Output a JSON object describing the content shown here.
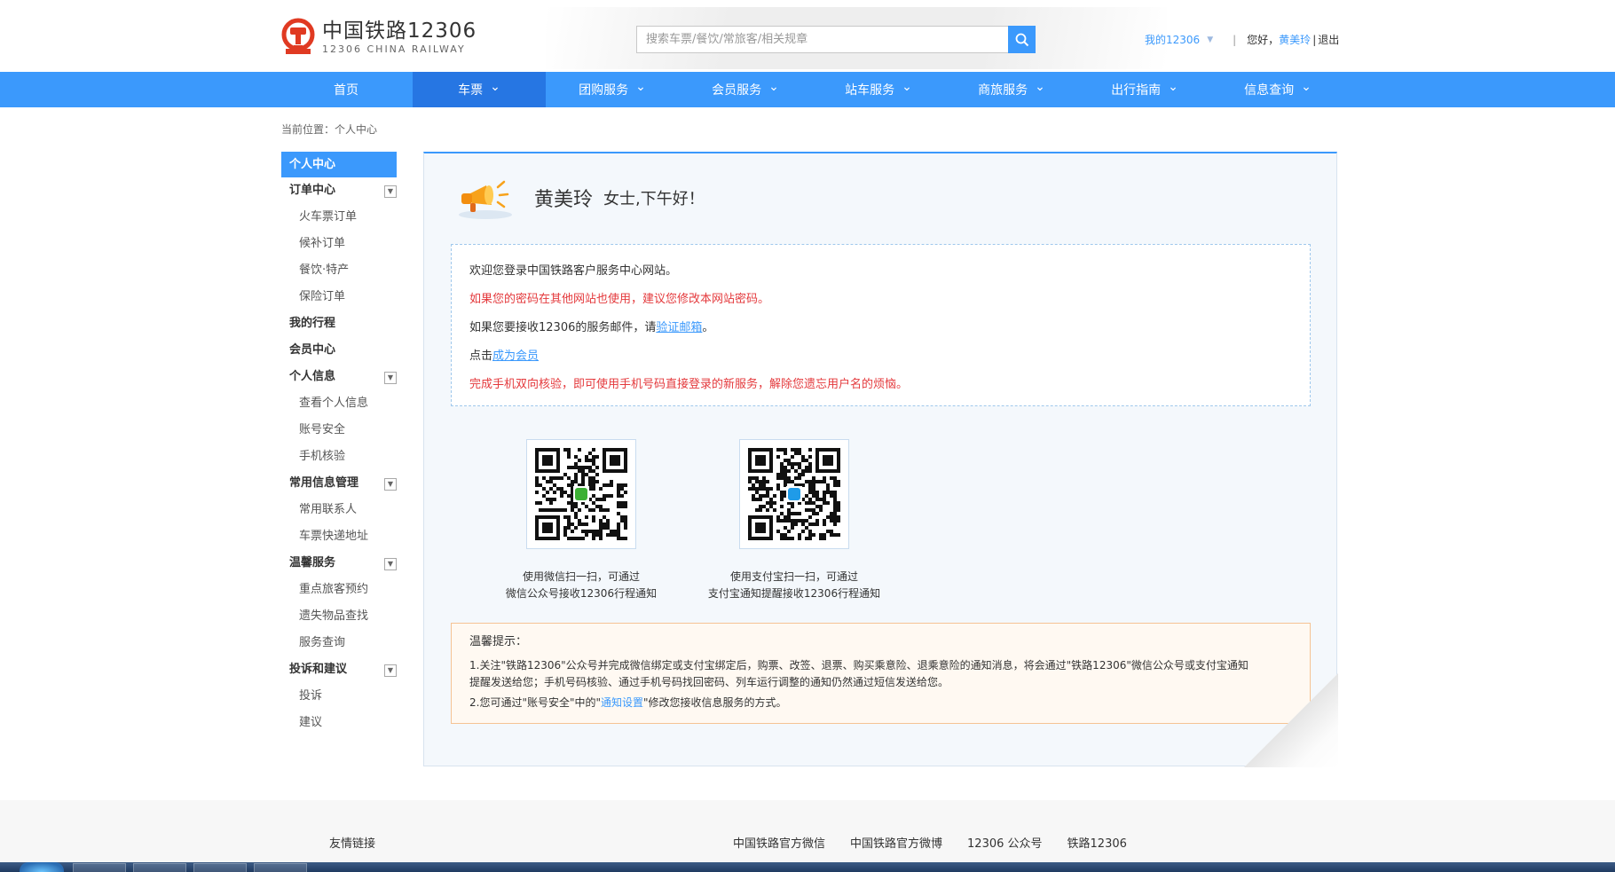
{
  "header": {
    "logo_cn": "中国铁路12306",
    "logo_en": "12306 CHINA RAILWAY",
    "search_placeholder": "搜索车票/餐饮/常旅客/相关规章",
    "my12306": "我的12306",
    "greeting_prefix": "您好，",
    "username": "黄美玲",
    "divider": "|",
    "logout": "退出"
  },
  "nav": [
    {
      "label": "首页",
      "has_dropdown": false,
      "active": false
    },
    {
      "label": "车票",
      "has_dropdown": true,
      "active": true
    },
    {
      "label": "团购服务",
      "has_dropdown": true,
      "active": false
    },
    {
      "label": "会员服务",
      "has_dropdown": true,
      "active": false
    },
    {
      "label": "站车服务",
      "has_dropdown": true,
      "active": false
    },
    {
      "label": "商旅服务",
      "has_dropdown": true,
      "active": false
    },
    {
      "label": "出行指南",
      "has_dropdown": true,
      "active": false
    },
    {
      "label": "信息查询",
      "has_dropdown": true,
      "active": false
    }
  ],
  "breadcrumb": "当前位置：个人中心",
  "sidebar": {
    "head": "个人中心",
    "groups": [
      {
        "label": "订单中心",
        "collapsible": true,
        "items": [
          "火车票订单",
          "候补订单",
          "餐饮·特产",
          "保险订单"
        ]
      },
      {
        "label": "我的行程",
        "collapsible": false,
        "items": []
      },
      {
        "label": "会员中心",
        "collapsible": false,
        "items": []
      },
      {
        "label": "个人信息",
        "collapsible": true,
        "items": [
          "查看个人信息",
          "账号安全",
          "手机核验"
        ]
      },
      {
        "label": "常用信息管理",
        "collapsible": true,
        "items": [
          "常用联系人",
          "车票快递地址"
        ]
      },
      {
        "label": "温馨服务",
        "collapsible": true,
        "items": [
          "重点旅客预约",
          "遗失物品查找",
          "服务查询"
        ]
      },
      {
        "label": "投诉和建议",
        "collapsible": true,
        "items": [
          "投诉",
          "建议"
        ]
      }
    ]
  },
  "greeting": {
    "name": "黄美玲",
    "suffix": "女士,下午好！"
  },
  "notice": {
    "line1": "欢迎您登录中国铁路客户服务中心网站。",
    "line2": "如果您的密码在其他网站也使用，建议您修改本网站密码。",
    "line3_prefix": "如果您要接收12306的服务邮件，请",
    "line3_link": "验证邮箱",
    "line3_suffix": "。",
    "line4_prefix": "点击",
    "line4_link": "成为会员",
    "line5": "完成手机双向核验，即可使用手机号码直接登录的新服务，解除您遗忘用户名的烦恼。"
  },
  "qr": [
    {
      "caption_line1": "使用微信扫一扫，可通过",
      "caption_line2": "微信公众号接收12306行程通知",
      "center_color": "#3cb034"
    },
    {
      "caption_line1": "使用支付宝扫一扫，可通过",
      "caption_line2": "支付宝通知提醒接收12306行程通知",
      "center_color": "#1f9be8"
    }
  ],
  "tips": {
    "title": "温馨提示：",
    "item1_line1": "1.关注\"铁路12306\"公众号并完成微信绑定或支付宝绑定后，购票、改签、退票、购买乘意险、退乘意险的通知消息，将会通过\"铁路12306\"微信公众号或支付宝通知",
    "item1_line2": "提醒发送给您；手机号码核验、通过手机号码找回密码、列车运行调整的通知仍然通过短信发送给您。",
    "item2_prefix": "2.您可通过\"账号安全\"中的\"",
    "item2_link": "通知设置",
    "item2_suffix": "\"修改您接收信息服务的方式。"
  },
  "footer": {
    "friend_links": "友情链接",
    "links": [
      "中国铁路官方微信",
      "中国铁路官方微博",
      "12306 公众号",
      "铁路12306"
    ]
  },
  "colors": {
    "brand_blue": "#3b99fc",
    "nav_active": "#2676e3",
    "logo_red": "#e03a22",
    "warning_red": "#e4393c"
  }
}
